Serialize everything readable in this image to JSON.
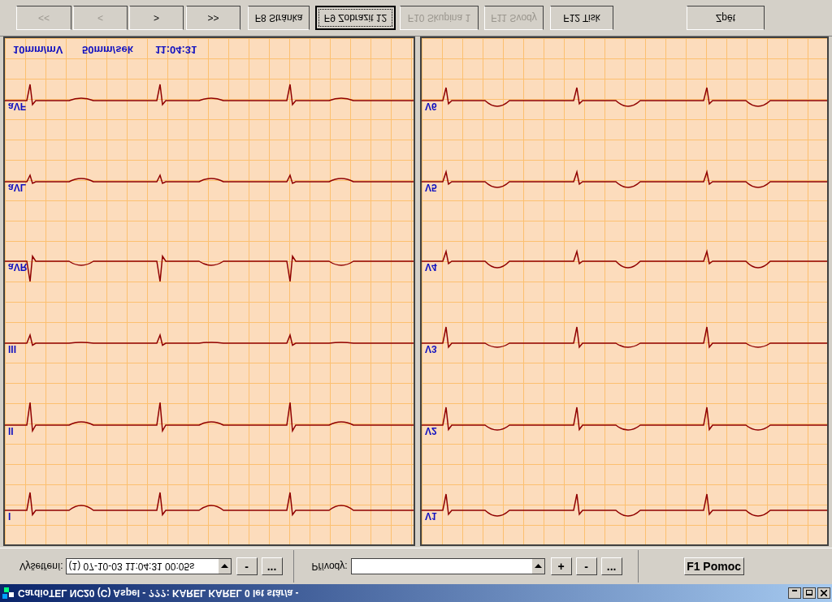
{
  "window": {
    "title": "CardioTEL NC20 (C) Aspel - ???: KAREL KAREL 0 let stár/a -"
  },
  "toolbar": {
    "buttons": [
      {
        "label": "<<",
        "disabled": true,
        "focused": false
      },
      {
        "label": "<",
        "disabled": true,
        "focused": false
      },
      {
        "label": ">",
        "disabled": false,
        "focused": false
      },
      {
        "label": ">>",
        "disabled": false,
        "focused": false
      },
      {
        "label": "F8 Stránka",
        "disabled": false,
        "focused": false
      },
      {
        "label": "F9 Zobrazit 12",
        "disabled": false,
        "focused": true
      },
      {
        "label": "F10 Skupina 1",
        "disabled": true,
        "focused": false
      },
      {
        "label": "F11 Svody",
        "disabled": true,
        "focused": false
      },
      {
        "label": "F12 Tisk",
        "disabled": false,
        "focused": false
      },
      {
        "label": "Zpět",
        "disabled": false,
        "focused": false
      }
    ]
  },
  "chart": {
    "scale": "10mm/mV",
    "speed": "50mm/sek",
    "time": "11:04:31",
    "left_leads": [
      "aVF",
      "aVL",
      "aVR",
      "III",
      "II",
      "I"
    ],
    "right_leads": [
      "V6",
      "V5",
      "V4",
      "V3",
      "V2",
      "V1"
    ]
  },
  "exam": {
    "label": "Vyšetření:",
    "value": "(1) 07-10-03 11:04:31 00:05s",
    "buttons": [
      "-",
      "..."
    ]
  },
  "leads_field": {
    "label": "Přívody:",
    "buttons": [
      "+",
      "-",
      "..."
    ]
  },
  "help_button": "F1 Pomoc"
}
